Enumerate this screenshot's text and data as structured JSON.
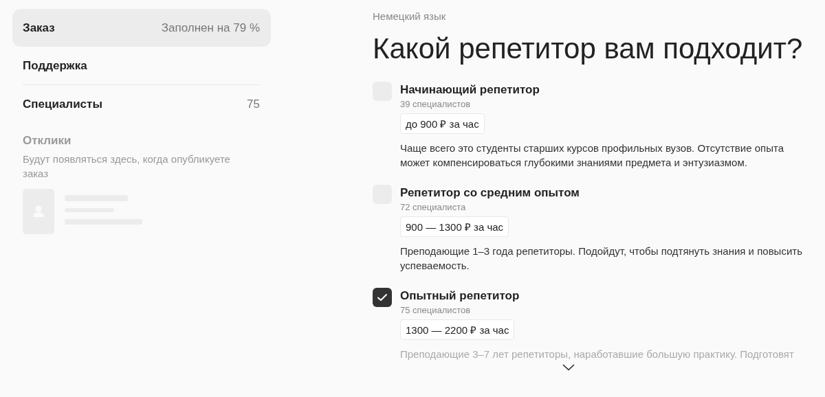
{
  "sidebar": {
    "items": [
      {
        "label": "Заказ",
        "value": "Заполнен на 79 %",
        "selected": true
      },
      {
        "label": "Поддержка",
        "selected": false
      },
      {
        "label": "Специалисты",
        "value": "75",
        "selected": false
      }
    ],
    "responses": {
      "title": "Отклики",
      "text": "Будут появляться здесь, когда опубликуете заказ"
    }
  },
  "main": {
    "subject": "Немецкий язык",
    "title": "Какой репетитор вам подходит?",
    "options": [
      {
        "title": "Начинающий репетитор",
        "count": "39 специалистов",
        "price": "до 900 ₽ за час",
        "description": "Чаще всего это студенты старших курсов профильных вузов. Отсутствие опыта может компенсироваться глубокими знаниями предмета и энтузиазмом.",
        "checked": false,
        "faded": false
      },
      {
        "title": "Репетитор со средним опытом",
        "count": "72 специалиста",
        "price": "900 — 1300 ₽ за час",
        "description": "Преподающие 1–3 года репетиторы. Подойдут, чтобы подтянуть знания и повысить успеваемость.",
        "checked": false,
        "faded": false
      },
      {
        "title": "Опытный репетитор",
        "count": "75 специалистов",
        "price": "1300 — 2200 ₽ за час",
        "description": "Преподающие 3–7 лет репетиторы, наработавшие большую практику. Подготовят",
        "checked": true,
        "faded": true
      }
    ]
  }
}
